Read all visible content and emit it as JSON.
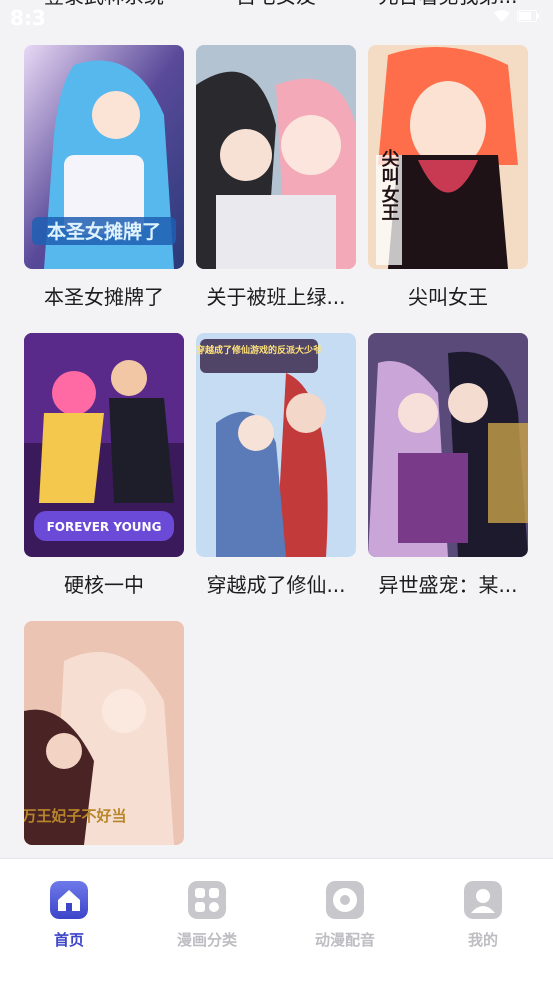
{
  "status_bar": {
    "time": "8:3"
  },
  "top_row": [
    {
      "title": "登录武林系统"
    },
    {
      "title": "自宅女友"
    },
    {
      "title": "兄台看见我弟..."
    }
  ],
  "comics": [
    {
      "title": "本圣女摊牌了",
      "cover_text": "本圣女摊牌了",
      "palette": [
        "#2a3a78",
        "#7ec8ff",
        "#f7d8ec"
      ]
    },
    {
      "title": "关于被班上绿...",
      "cover_text": "",
      "palette": [
        "#9fb5c9",
        "#f7c3cf",
        "#2a2a2e"
      ]
    },
    {
      "title": "尖叫女王",
      "cover_text": "尖叫女王",
      "palette": [
        "#7b1f2c",
        "#ff7d5a",
        "#f5d6b0"
      ]
    },
    {
      "title": "硬核一中",
      "cover_text": "FOREVER YOUNG",
      "palette": [
        "#3a1a5a",
        "#c43aa8",
        "#f3c84c"
      ]
    },
    {
      "title": "穿越成了修仙...",
      "cover_text": "穿越成了修仙游戏的反派大少爷",
      "palette": [
        "#b9d3ef",
        "#3a2a4a",
        "#e85050"
      ]
    },
    {
      "title": "异世盛宠：某...",
      "cover_text": "",
      "palette": [
        "#4a3a6a",
        "#c7a1d8",
        "#1a1a2a"
      ]
    },
    {
      "title": "",
      "cover_text": "万王妃子不好当",
      "palette": [
        "#e9b7a4",
        "#5a2a2a",
        "#f3d3c3"
      ]
    }
  ],
  "bottom_nav": [
    {
      "label": "首页",
      "active": true,
      "icon": "home-icon"
    },
    {
      "label": "漫画分类",
      "active": false,
      "icon": "category-grid-icon"
    },
    {
      "label": "动漫配音",
      "active": false,
      "icon": "disc-icon"
    },
    {
      "label": "我的",
      "active": false,
      "icon": "profile-icon"
    }
  ],
  "colors": {
    "accent": "#3c45c8",
    "inactive": "#bdbdc2",
    "background": "#f3f3f5"
  }
}
